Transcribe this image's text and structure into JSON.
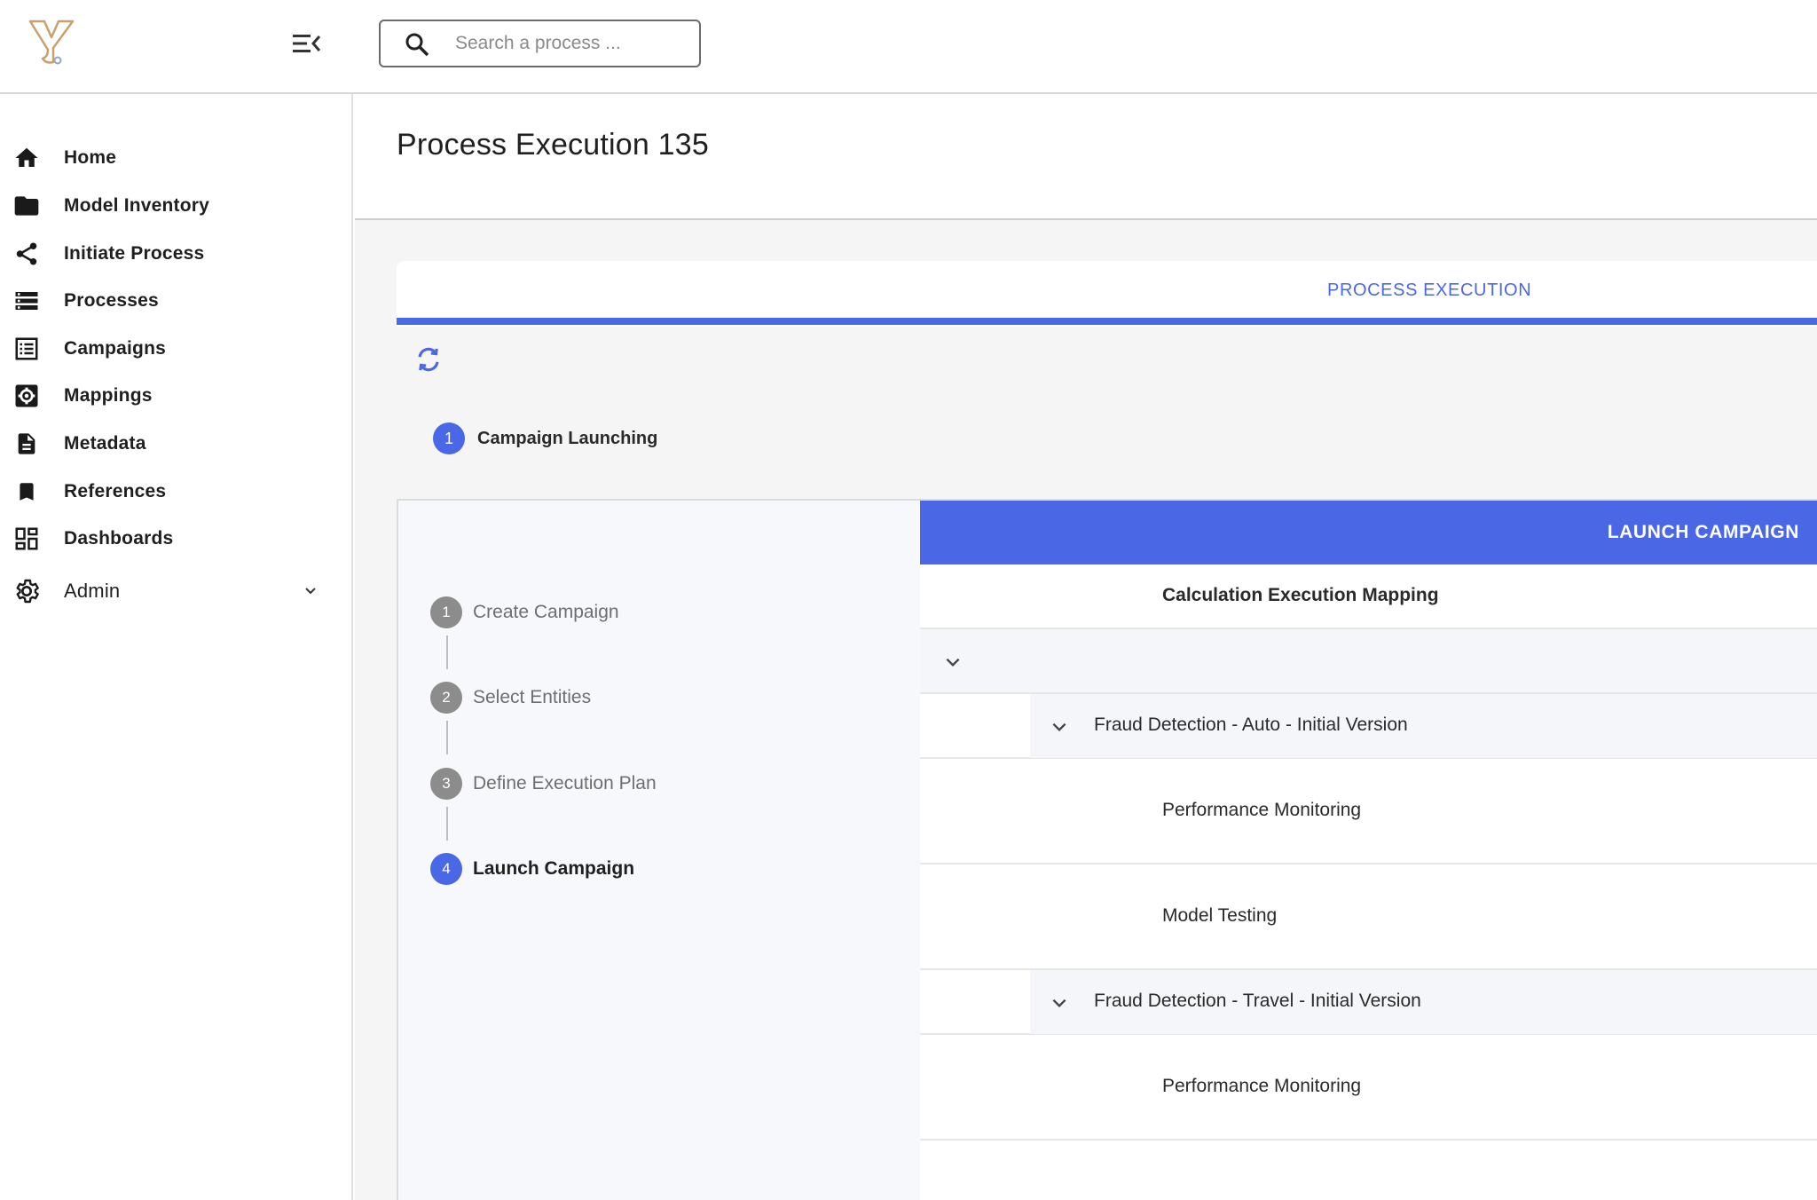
{
  "search": {
    "placeholder": "Search a process ..."
  },
  "sidebar": {
    "items": [
      {
        "label": "Home",
        "icon": "home-icon"
      },
      {
        "label": "Model Inventory",
        "icon": "folder-icon"
      },
      {
        "label": "Initiate Process",
        "icon": "share-icon"
      },
      {
        "label": "Processes",
        "icon": "list-icon"
      },
      {
        "label": "Campaigns",
        "icon": "checklist-icon"
      },
      {
        "label": "Mappings",
        "icon": "gear-box-icon"
      },
      {
        "label": "Metadata",
        "icon": "document-icon"
      },
      {
        "label": "References",
        "icon": "bookmark-icon"
      },
      {
        "label": "Dashboards",
        "icon": "dashboard-icon"
      },
      {
        "label": "Admin",
        "icon": "gear-icon"
      }
    ]
  },
  "page": {
    "title": "Process Execution 135"
  },
  "tabs": [
    {
      "label": "PROCESS EXECUTION",
      "active": true
    }
  ],
  "phase": {
    "number": "1",
    "label": "Campaign Launching"
  },
  "steps": [
    {
      "number": "1",
      "label": "Create Campaign",
      "active": false
    },
    {
      "number": "2",
      "label": "Select Entities",
      "active": false
    },
    {
      "number": "3",
      "label": "Define Execution Plan",
      "active": false
    },
    {
      "number": "4",
      "label": "Launch Campaign",
      "active": true
    }
  ],
  "content": {
    "launch_label": "LAUNCH CAMPAIGN",
    "column_header": "Calculation Execution Mapping",
    "groups": [
      {
        "title": "Fraud Detection - Auto - Initial Version",
        "items": [
          "Performance Monitoring",
          "Model Testing"
        ]
      },
      {
        "title": "Fraud Detection - Travel - Initial Version",
        "items": [
          "Performance Monitoring"
        ]
      }
    ]
  },
  "colors": {
    "accent": "#4a67e6",
    "logo": "#c9a06a"
  }
}
